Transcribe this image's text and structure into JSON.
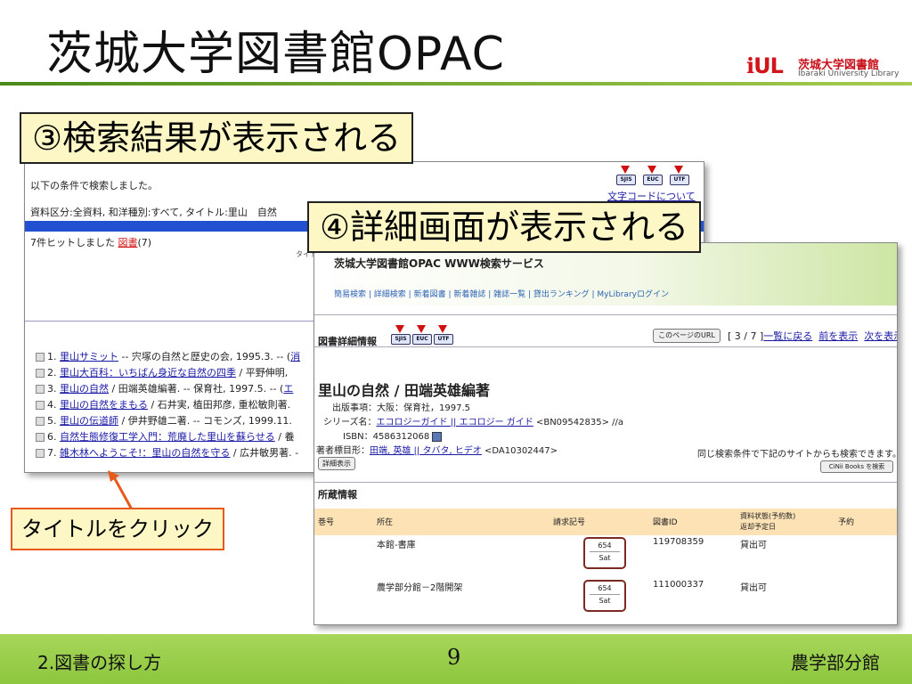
{
  "slide": {
    "title": "茨城大学図書館OPAC",
    "logo_mark": "ℹUL",
    "logo_jp": "茨城大学図書館",
    "logo_en": "Ibaraki University Library",
    "step3": "③検索結果が表示される",
    "step4": "④詳細画面が表示される",
    "click_note": "タイトルをクリック"
  },
  "results": {
    "condition_intro": "以下の条件で検索しました。",
    "condition": "資料区分:全資料, 和洋種別:すべて, タイトル:里山　自然",
    "hits_prefix": "7件ヒットしました ",
    "hits_link": "図書",
    "hits_suffix": "(7)",
    "encoding_buttons": [
      "SJIS",
      "EUC",
      "UTF"
    ],
    "charset_link": "文字コードについて",
    "sort_label": "タイト",
    "items": [
      {
        "num": "1.",
        "title": "里山サミット",
        "rest": " -- 宍塚の自然と歴史の会, 1995.3. -- (",
        "tail": "消"
      },
      {
        "num": "2.",
        "title": "里山大百科：いちばん身近な自然の四季",
        "rest": " / 平野伸明,",
        "tail": ""
      },
      {
        "num": "3.",
        "title": "里山の自然",
        "rest": " / 田端英雄編著. -- 保育社, 1997.5. -- (",
        "tail": "エ"
      },
      {
        "num": "4.",
        "title": "里山の自然をまもる",
        "rest": " / 石井実, 植田邦彦, 重松敏則著.",
        "tail": ""
      },
      {
        "num": "5.",
        "title": "里山の伝道師",
        "rest": " / 伊井野雄二著. -- コモンズ, 1999.11.",
        "tail": ""
      },
      {
        "num": "6.",
        "title": "自然生態修復工学入門：荒廃した里山を蘇らせる",
        "rest": " / 養",
        "tail": ""
      },
      {
        "num": "7.",
        "title": "雑木林へようこそ!：里山の自然を守る",
        "rest": " / 広井敏男著. -",
        "tail": ""
      }
    ]
  },
  "detail": {
    "service_title": "茨城大学図書館OPAC WWW検索サービス",
    "nav": [
      "簡易検索",
      "詳細検索",
      "新着図書",
      "新着雑誌",
      "雑誌一覧",
      "貸出ランキング",
      "MyLibraryログイン"
    ],
    "section_detail": "図書詳細情報",
    "page_url_btn": "このページのURL",
    "position": "[ 3 / 7 ]",
    "back_link": "一覧に戻る",
    "prev_link": "前を表示",
    "next_link": "次を表示",
    "book_title": "里山の自然 / 田端英雄編著",
    "pub_label": "出版事項：",
    "pub_value": "大阪：保育社，1997.5",
    "series_label": "シリーズ名：",
    "series_link": "エコロジーガイド || エコロジー ガイド",
    "series_rest": " <BN09542835> //a",
    "isbn_label": "ISBN：",
    "isbn_value": "4586312068",
    "author_label": "著者標目形：",
    "author_link": "田端, 英雄 || タバタ, ヒデオ",
    "author_rest": " <DA10302447>",
    "detail_btn": "詳細表示",
    "same_search": "同じ検索条件で下記のサイトからも検索できます。",
    "cinii_btn": "CiNii Books を検索",
    "section_holdings": "所蔵情報",
    "columns": [
      "巻号",
      "所在",
      "請求記号",
      "図書ID",
      "資料状態(予約数)",
      "返却予定日",
      "予約"
    ],
    "holdings": [
      {
        "location": "本館-書庫",
        "call1": "654",
        "call2": "Sat",
        "id": "119708359",
        "status": "貸出可"
      },
      {
        "location": "農学部分館－2階開架",
        "call1": "654",
        "call2": "Sat",
        "id": "111000337",
        "status": "貸出可"
      }
    ]
  },
  "footer": {
    "section": "2.図書の探し方",
    "page": "9",
    "branch": "農学部分館"
  }
}
